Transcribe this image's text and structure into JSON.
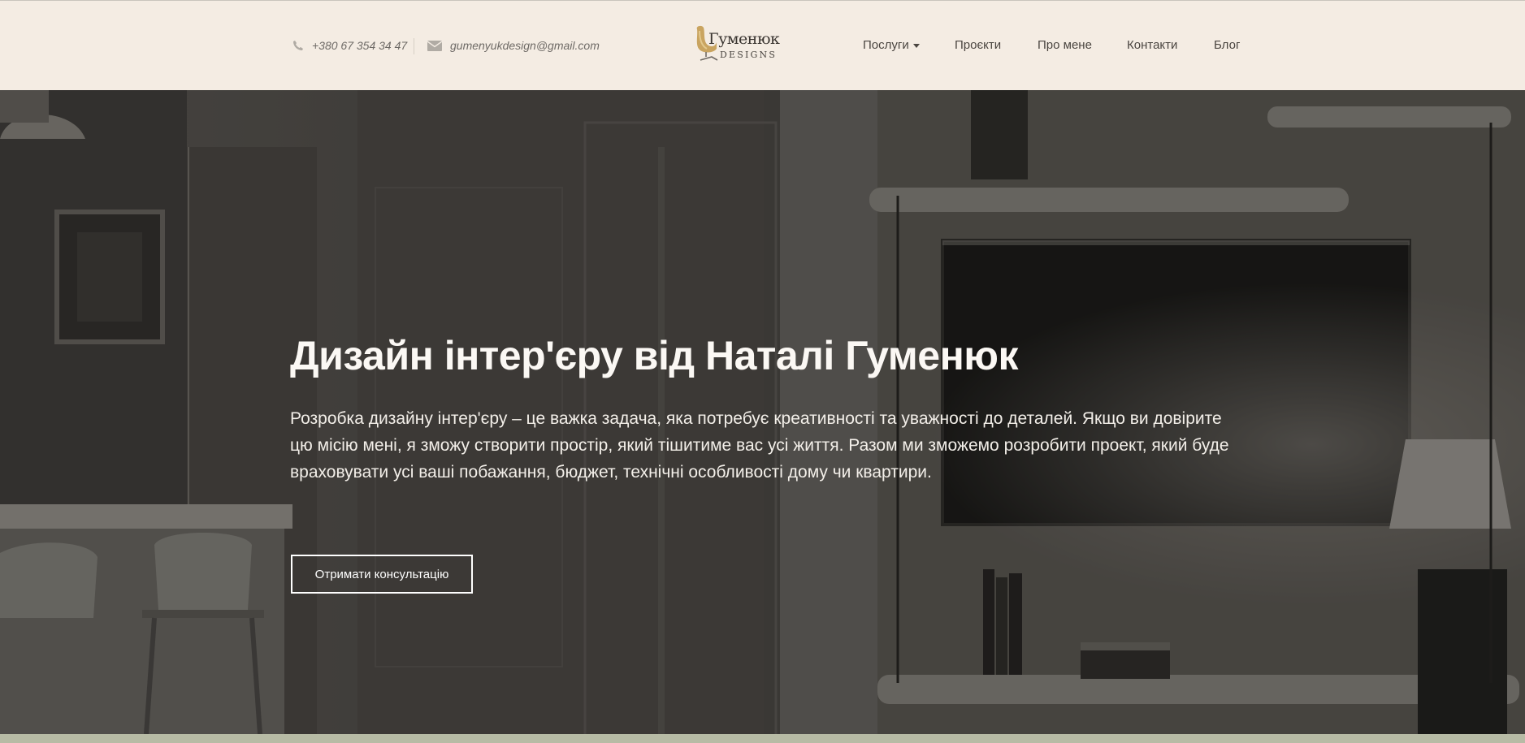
{
  "header": {
    "phone": "+380 67 354 34 47",
    "email": "gumenyukdesign@gmail.com",
    "logo": {
      "name": "Гуменюк",
      "sub": "DESIGNS"
    },
    "nav": {
      "services": "Послуги",
      "projects": "Проєкти",
      "about": "Про мене",
      "contacts": "Контакти",
      "blog": "Блог"
    }
  },
  "hero": {
    "title": "Дизайн інтер'єру від Наталі Гуменюк",
    "text": "Розробка дизайну інтер'єру – це важка задача, яка потребує креативності та уважності до деталей. Якщо ви довірите цю місію мені, я зможу створити простір, який тішитиме вас усі життя. Разом ми зможемо розробити проект, який буде враховувати усі ваші побажання, бюджет, технічні особливості дому чи квартири.",
    "cta": "Отримати консультацію"
  },
  "colors": {
    "header_bg": "#f4ece3",
    "accent_gold": "#c9a460",
    "hero_overlay": "#3b3835"
  },
  "icons": {
    "phone": "phone-icon",
    "email": "envelope-icon",
    "caret": "caret-down-icon",
    "logo": "chair-logo-icon"
  }
}
